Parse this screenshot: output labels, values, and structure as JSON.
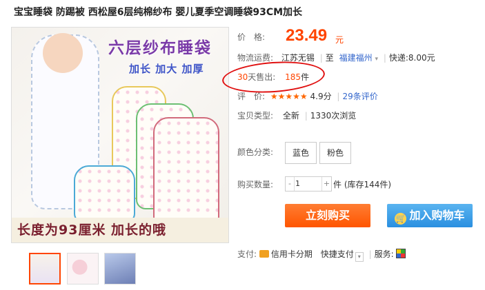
{
  "product": {
    "title": "宝宝睡袋 防踢被 西松屋6层纯棉纱布 婴儿夏季空调睡袋93CM加长"
  },
  "main_image": {
    "title_text": "六层纱布睡袋",
    "subtitle_text": "加长 加大 加厚",
    "caption_text": "长度为93厘米 加长的哦"
  },
  "price": {
    "label": "价　格:",
    "value": "23.49",
    "unit": "元"
  },
  "shipping": {
    "label": "物流运费:",
    "from": "江苏无锡",
    "to_prefix": "至",
    "to": "福建福州",
    "dropdown_icon": "chevron-down-icon",
    "express": "快递:8.00元"
  },
  "sales": {
    "days": "30",
    "label": "天售出:",
    "count": "185",
    "unit": "件"
  },
  "rating": {
    "label": "评　价:",
    "stars": 4.9,
    "score": "4.9分",
    "reviews": "29条评价"
  },
  "type": {
    "label": "宝贝类型:",
    "condition": "全新",
    "views": "1330次浏览"
  },
  "color": {
    "label": "颜色分类:",
    "options": [
      "蓝色",
      "粉色"
    ]
  },
  "quantity": {
    "label": "购买数量:",
    "minus": "-",
    "value": "1",
    "plus": "+",
    "unit_stock": "件 (库存144件)"
  },
  "buttons": {
    "buy_now": "立刻购买",
    "add_cart": "加入购物车"
  },
  "payment": {
    "label": "支付:",
    "credit": "信用卡分期",
    "fast": "快捷支付",
    "service_label": "服务:"
  },
  "colors": {
    "accent": "#ff4400",
    "buy_button": "#ff5500",
    "cart_button": "#2a8fe0",
    "link": "#3366cc",
    "annotation_circle": "#e01010"
  }
}
